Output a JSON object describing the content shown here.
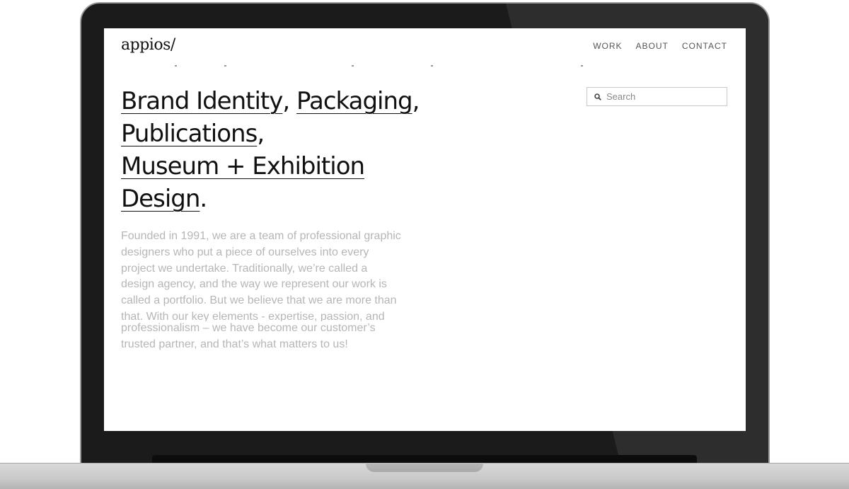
{
  "site": {
    "logo": "appios/"
  },
  "nav": {
    "items": [
      "WORK",
      "ABOUT",
      "CONTACT"
    ]
  },
  "search": {
    "placeholder": "Search"
  },
  "headline": {
    "parts": [
      "Brand Identity",
      ", ",
      "Packaging",
      ",",
      "Publications",
      ",",
      "Museum + Exhibition",
      "Design",
      "."
    ]
  },
  "intro": {
    "lines": [
      "Founded in 1991, we are a team of professional graphic",
      "designers who put a piece of ourselves into every",
      "project we undertake. Traditionally, we’re called a",
      "design agency, and the way we represent our work is",
      "called a portfolio. But we believe that we are more than",
      "that. With our key elements - expertise, passion, and",
      "professionalism – we have become our customer’s",
      "trusted partner, and that’s what matters to us!"
    ]
  },
  "colors": {
    "bezel": "#1b1b1b",
    "text": "#111111",
    "muted": "#b6b6b6"
  }
}
